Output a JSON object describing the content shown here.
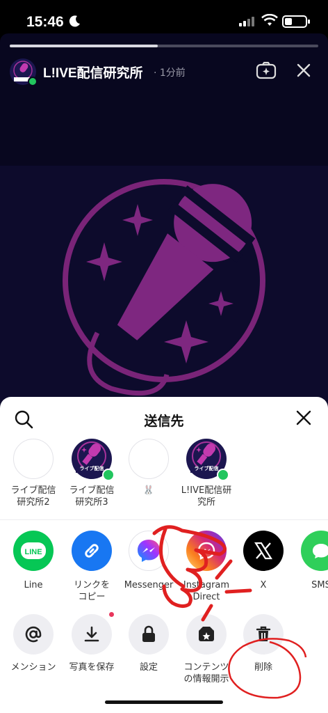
{
  "status_bar": {
    "time": "15:46"
  },
  "story": {
    "progress": 0.48,
    "account_name": "L!IVE配信研究所",
    "posted_ago": "· 1分前",
    "avatar_caption": "ライブ配信"
  },
  "share_sheet": {
    "title": "送信先",
    "contacts": [
      {
        "label": "ライブ配信\n研究所2",
        "online": false
      },
      {
        "label": "ライブ配信\n研究所3",
        "online": true
      },
      {
        "label": "🐰",
        "online": false
      },
      {
        "label": "L!IVE配信研\n究所",
        "online": true
      }
    ],
    "apps": [
      {
        "label": "Line",
        "color": "#06c755",
        "icon_name": "line-icon"
      },
      {
        "label": "リンクを\nコピー",
        "color": "#1877f2",
        "icon_name": "link-icon"
      },
      {
        "label": "Messenger",
        "color": "#ffffff",
        "icon_name": "messenger-icon"
      },
      {
        "label": "Instagram\nDirect",
        "color": "#e4405f",
        "icon_name": "instagram-direct-icon"
      },
      {
        "label": "X",
        "color": "#000000",
        "icon_name": "x-icon"
      },
      {
        "label": "SMS",
        "color": "#2fcf5a",
        "icon_name": "sms-icon"
      }
    ],
    "actions": [
      {
        "label": "メンション",
        "icon_name": "at-icon"
      },
      {
        "label": "写真を保存",
        "icon_name": "download-icon",
        "badge": true
      },
      {
        "label": "設定",
        "icon_name": "lock-icon"
      },
      {
        "label": "コンテンツ\nの情報開示",
        "icon_name": "disclosure-icon"
      },
      {
        "label": "削除",
        "icon_name": "trash-icon"
      }
    ]
  },
  "colors": {
    "story_bg": "#08071f",
    "brand_purple": "#8a2a8a",
    "annotation_red": "#e02020"
  }
}
